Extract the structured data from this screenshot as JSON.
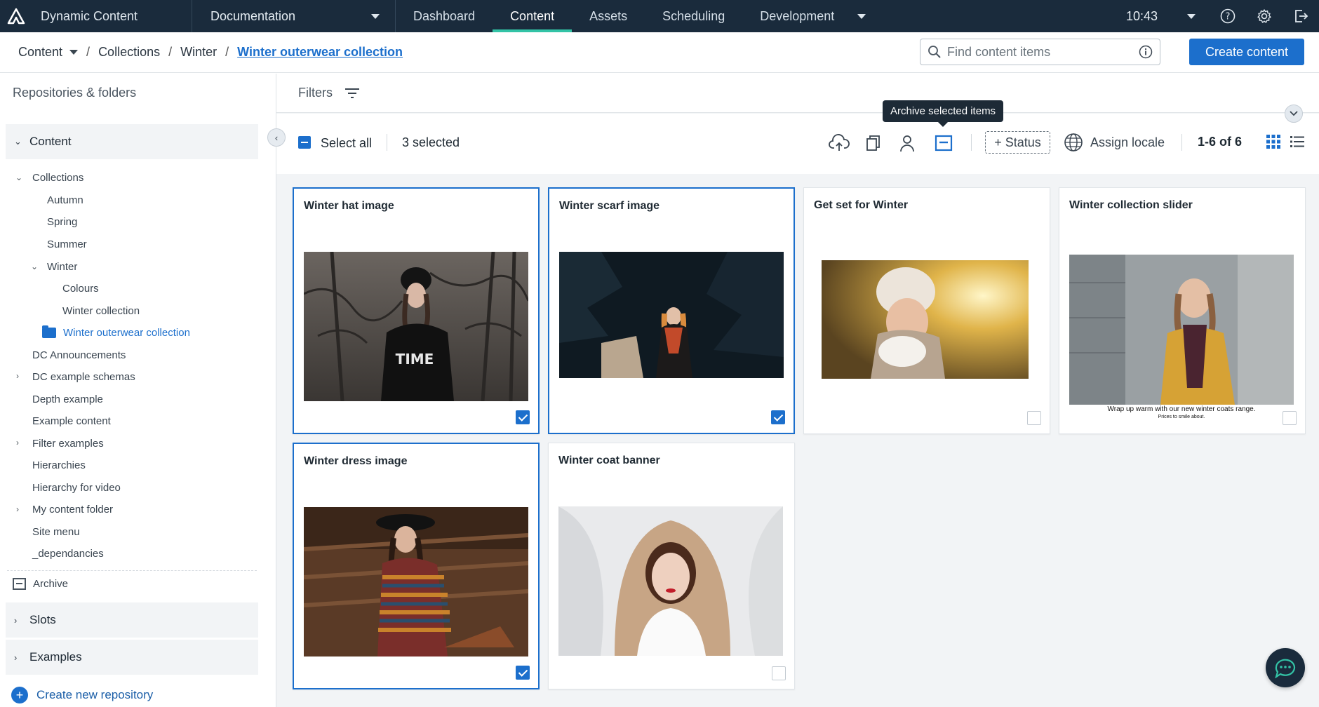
{
  "topbar": {
    "app_name": "Dynamic Content",
    "hub": "Documentation",
    "nav": [
      "Dashboard",
      "Content",
      "Assets",
      "Scheduling",
      "Development"
    ],
    "active_nav": "Content",
    "time": "10:43"
  },
  "breadcrumb": {
    "root": "Content",
    "items": [
      "Collections",
      "Winter"
    ],
    "current": "Winter outerwear collection"
  },
  "search": {
    "placeholder": "Find content items"
  },
  "create_button": "Create content",
  "sidebar": {
    "title": "Repositories & folders",
    "content_group": "Content",
    "tree": {
      "collections": "Collections",
      "autumn": "Autumn",
      "spring": "Spring",
      "summer": "Summer",
      "winter": "Winter",
      "colours": "Colours",
      "winter_collection": "Winter collection",
      "winter_outerwear": "Winter outerwear collection",
      "dc_announcements": "DC Announcements",
      "dc_example_schemas": "DC example schemas",
      "depth_example": "Depth example",
      "example_content": "Example content",
      "filter_examples": "Filter examples",
      "hierarchies": "Hierarchies",
      "hierarchy_video": "Hierarchy for video",
      "my_content_folder": "My content folder",
      "site_menu": "Site menu",
      "dependancies": "_dependancies"
    },
    "archive": "Archive",
    "slots": "Slots",
    "examples": "Examples",
    "new_repo": "Create new repository"
  },
  "main": {
    "filters": "Filters",
    "select_all": "Select all",
    "selected": "3 selected",
    "status_button": "+ Status",
    "assign_locale": "Assign locale",
    "count": "1-6 of 6",
    "tooltip": "Archive selected items"
  },
  "cards": [
    {
      "title": "Winter hat image",
      "selected": true
    },
    {
      "title": "Winter scarf image",
      "selected": true
    },
    {
      "title": "Get set for Winter",
      "selected": false
    },
    {
      "title": "Winter collection slider",
      "selected": false,
      "caption_main": "Wrap up warm with our new winter coats range.",
      "caption_sub": "Prices to smile about."
    },
    {
      "title": "Winter dress image",
      "selected": true
    },
    {
      "title": "Winter coat banner",
      "selected": false
    }
  ],
  "colors": {
    "topbar": "#1a2b3c",
    "accent": "#1c6fcc",
    "active_tab": "#33c3a6"
  }
}
